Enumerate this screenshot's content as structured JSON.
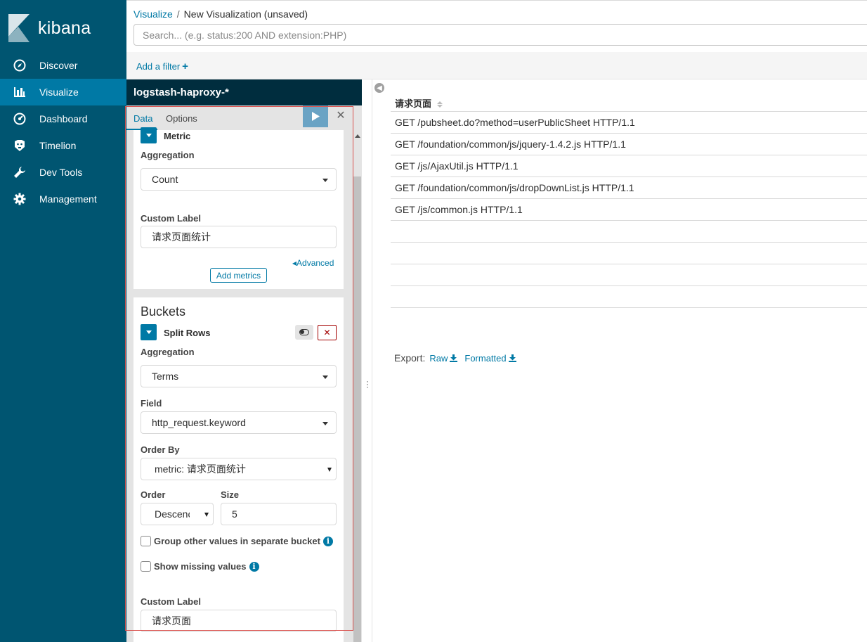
{
  "brand": {
    "name": "kibana"
  },
  "nav": [
    {
      "label": "Discover",
      "icon": "compass-icon"
    },
    {
      "label": "Visualize",
      "icon": "bar-chart-icon",
      "active": true
    },
    {
      "label": "Dashboard",
      "icon": "dashboard-icon"
    },
    {
      "label": "Timelion",
      "icon": "timelion-icon"
    },
    {
      "label": "Dev Tools",
      "icon": "wrench-icon"
    },
    {
      "label": "Management",
      "icon": "gear-icon"
    }
  ],
  "breadcrumb": {
    "link": "Visualize",
    "separator": "/",
    "current": "New Visualization (unsaved)"
  },
  "search": {
    "placeholder": "Search... (e.g. status:200 AND extension:PHP)"
  },
  "filter": {
    "add_label": "Add a filter",
    "plus": "+"
  },
  "editor": {
    "index_pattern": "logstash-haproxy-*",
    "tabs": [
      "Data",
      "Options"
    ],
    "active_tab": "Data",
    "metric": {
      "title": "Metric",
      "aggregation_label": "Aggregation",
      "aggregation_value": "Count",
      "custom_label_label": "Custom Label",
      "custom_label_value": "请求页面统计",
      "advanced_link": "Advanced",
      "add_metrics": "Add metrics"
    },
    "buckets": {
      "title": "Buckets",
      "split_title": "Split Rows",
      "aggregation_label": "Aggregation",
      "aggregation_value": "Terms",
      "field_label": "Field",
      "field_value": "http_request.keyword",
      "order_by_label": "Order By",
      "order_by_value": "metric: 请求页面统计",
      "order_label": "Order",
      "order_value": "Descenc",
      "size_label": "Size",
      "size_value": "5",
      "group_other_label": "Group other values in separate bucket",
      "show_missing_label": "Show missing values",
      "custom_label_label": "Custom Label",
      "custom_label_value": "请求页面"
    }
  },
  "results": {
    "column": "请求页面",
    "rows": [
      "GET /pubsheet.do?method=userPublicSheet HTTP/1.1",
      "GET /foundation/common/js/jquery-1.4.2.js HTTP/1.1",
      "GET /js/AjaxUtil.js HTTP/1.1",
      "GET /foundation/common/js/dropDownList.js HTTP/1.1",
      "GET /js/common.js HTTP/1.1",
      "",
      "",
      "",
      ""
    ],
    "export_label": "Export:",
    "export_raw": "Raw",
    "export_formatted": "Formatted"
  },
  "colors": {
    "sidebar": "#005571",
    "active": "#0079a5",
    "index_header": "#002d3e",
    "link": "#0079a5",
    "danger": "#a30000"
  }
}
